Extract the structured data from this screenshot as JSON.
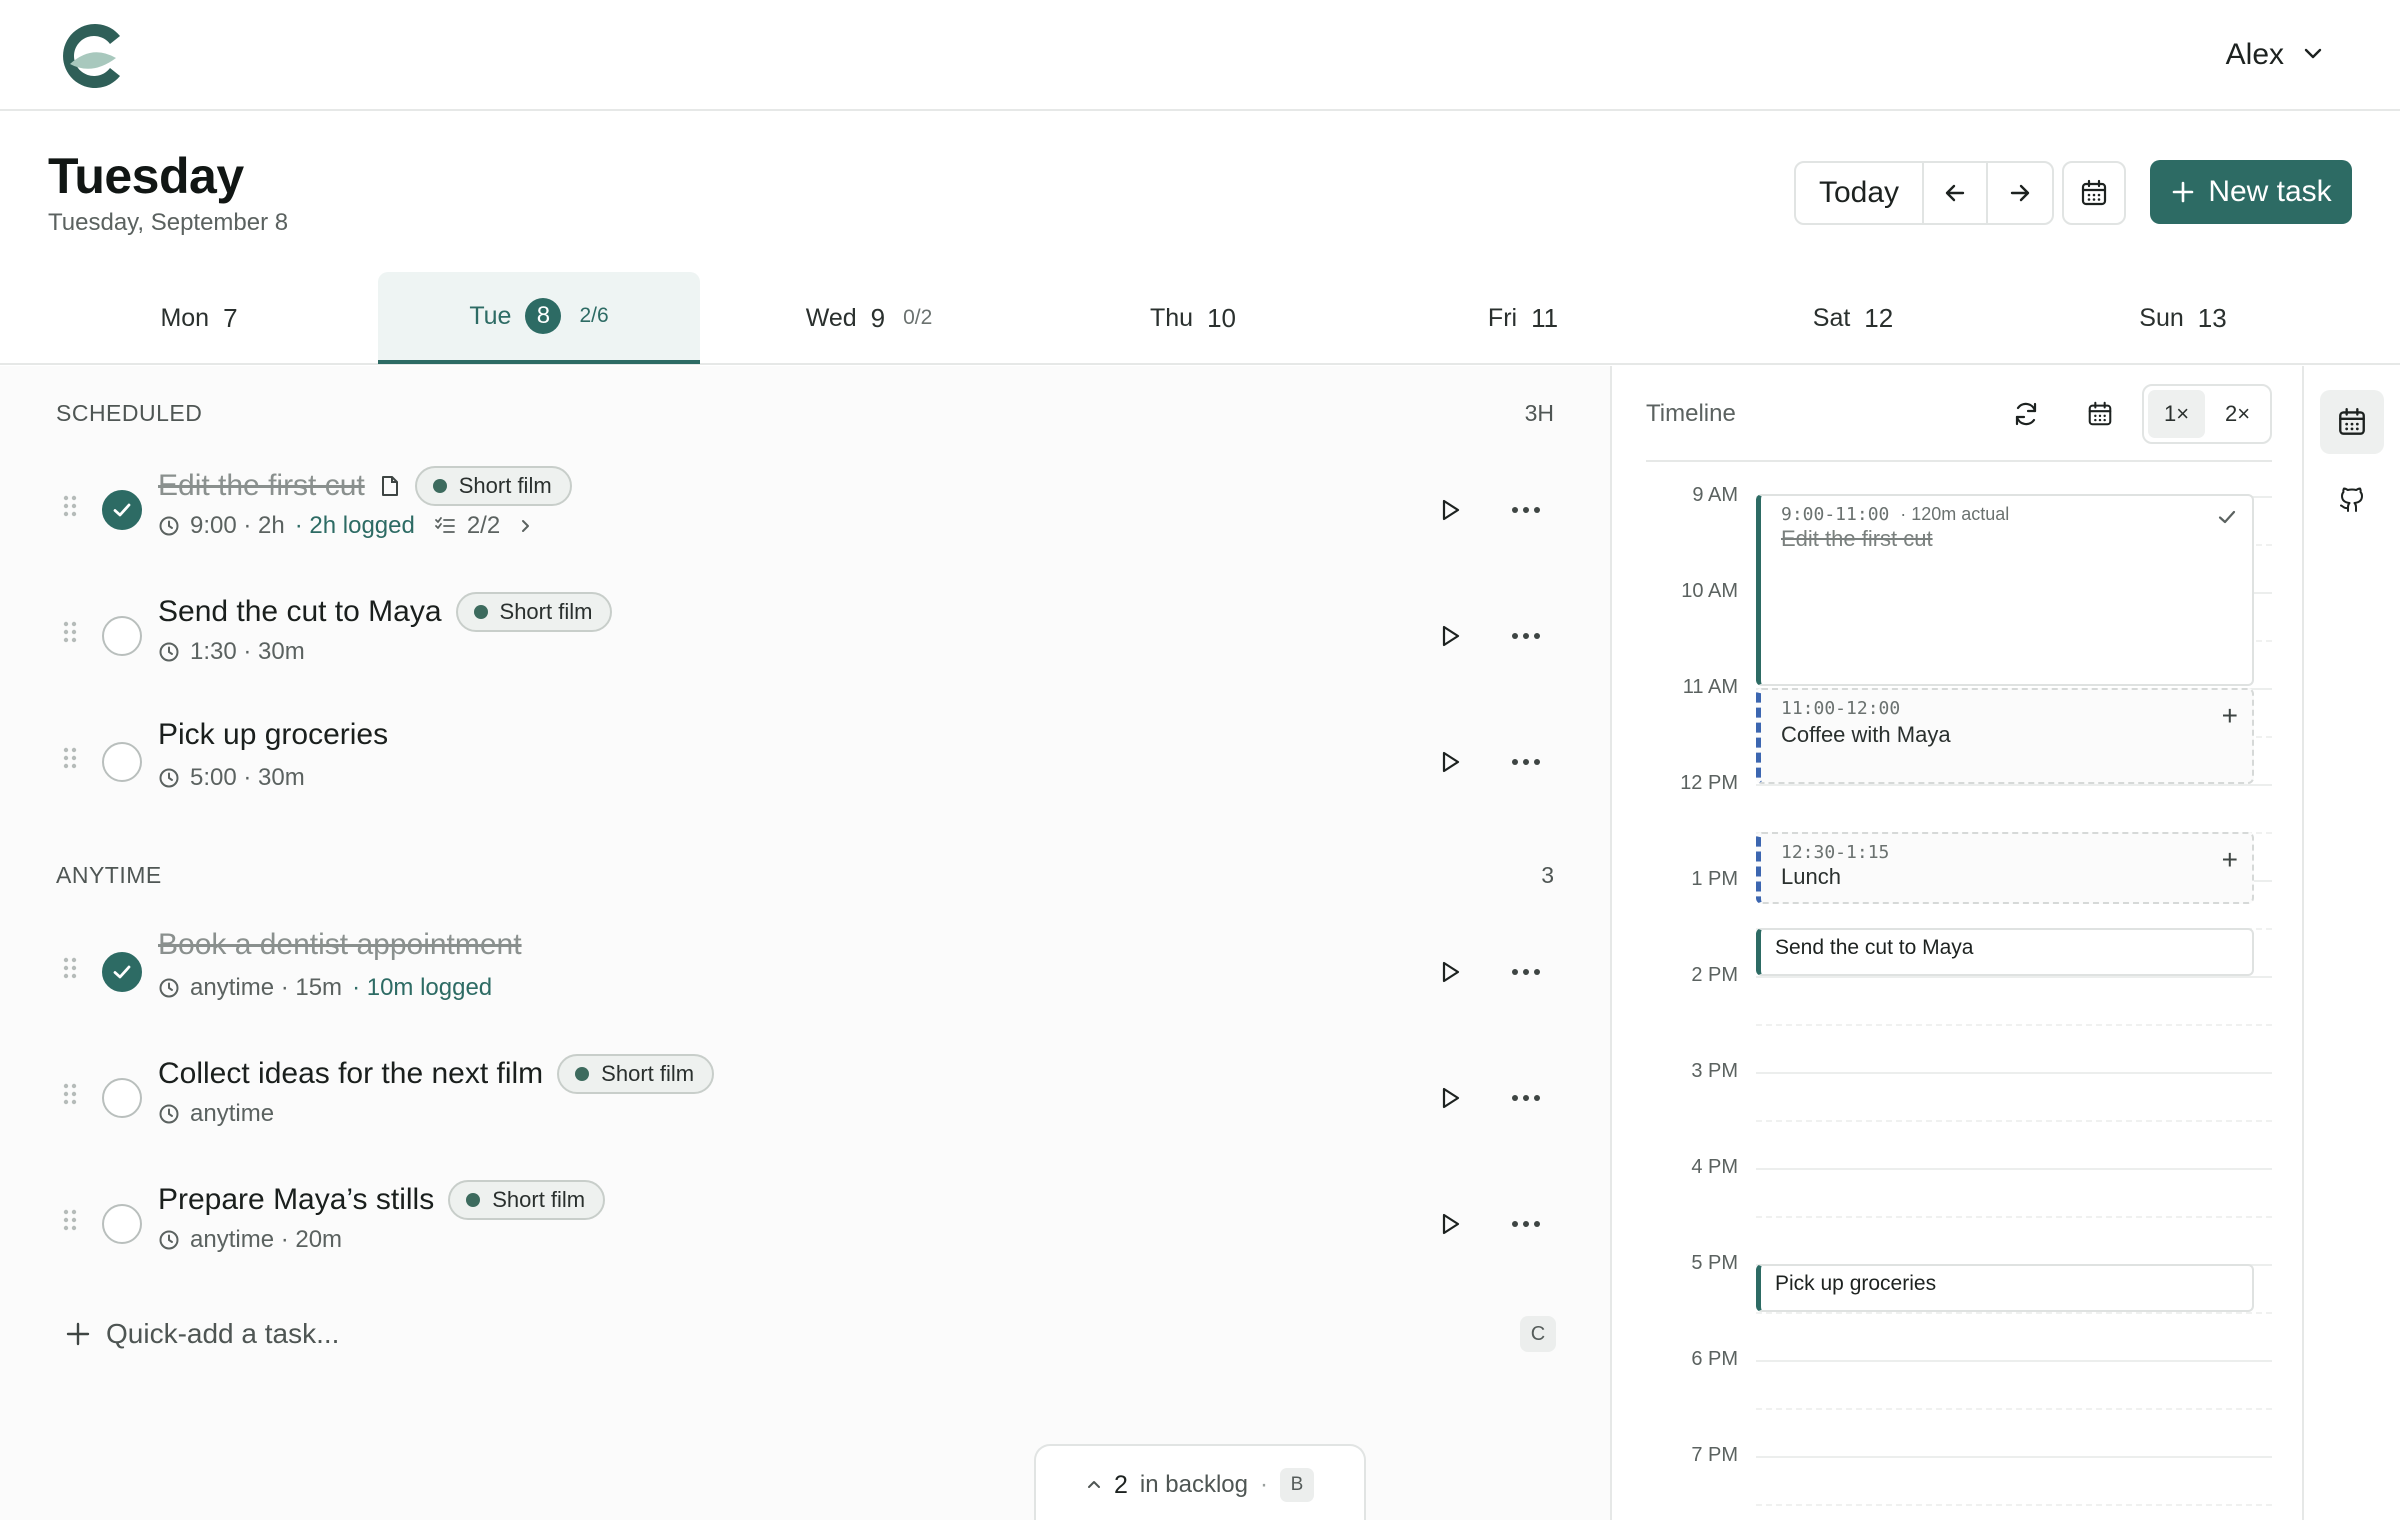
{
  "app": {
    "logo": "brand-logo",
    "accent": "#2d6b64"
  },
  "user": {
    "name": "Alex"
  },
  "header": {
    "title": "Tuesday",
    "subtitle": "Tuesday, September 8",
    "today_label": "Today",
    "new_task_label": "New task"
  },
  "days": [
    {
      "name": "Mon",
      "num": "7",
      "count": ""
    },
    {
      "name": "Tue",
      "num": "8",
      "count": "2/6"
    },
    {
      "name": "Wed",
      "num": "9",
      "count": "0/2"
    },
    {
      "name": "Thu",
      "num": "10",
      "count": ""
    },
    {
      "name": "Fri",
      "num": "11",
      "count": ""
    },
    {
      "name": "Sat",
      "num": "12",
      "count": ""
    },
    {
      "name": "Sun",
      "num": "13",
      "count": ""
    }
  ],
  "scheduled": {
    "label": "SCHEDULED",
    "meta": "3H",
    "tasks": [
      {
        "title": "Edit the first cut",
        "done": true,
        "tag": "Short film",
        "time": "9:00 · 2h",
        "logged": "· 2h logged",
        "subtasks": "2/2"
      },
      {
        "title": "Send the cut to Maya",
        "done": false,
        "tag": "Short film",
        "time": "1:30 · 30m",
        "logged": ""
      },
      {
        "title": "Pick up groceries",
        "done": false,
        "tag": "",
        "time": "5:00 · 30m",
        "logged": ""
      }
    ]
  },
  "anytime": {
    "label": "ANYTIME",
    "meta": "3",
    "tasks": [
      {
        "title": "Book a dentist appointment",
        "done": true,
        "tag": "",
        "time": "anytime · 15m",
        "logged": "· 10m logged"
      },
      {
        "title": "Collect ideas for the next film",
        "done": false,
        "tag": "Short film",
        "time": "anytime",
        "logged": ""
      },
      {
        "title": "Prepare Maya’s stills",
        "done": false,
        "tag": "Short film",
        "time": "anytime · 20m",
        "logged": ""
      }
    ]
  },
  "quickadd": {
    "placeholder": "Quick-add a task...",
    "shortcut": "C"
  },
  "backlog": {
    "count": "2",
    "label": "in backlog",
    "sep": "·",
    "shortcut": "B"
  },
  "timeline": {
    "title": "Timeline",
    "zoom_options": [
      "1×",
      "2×"
    ],
    "zoom_selected": "1×",
    "hours": [
      "9 AM",
      "10 AM",
      "11 AM",
      "12 PM",
      "1 PM",
      "2 PM",
      "3 PM",
      "4 PM",
      "5 PM",
      "6 PM",
      "7 PM"
    ],
    "events": [
      {
        "time": "9:00-11:00",
        "note": "· 120m actual",
        "name": "Edit the first cut",
        "kind": "task-done"
      },
      {
        "time": "11:00-12:00",
        "name": "Coffee with Maya",
        "kind": "calendar"
      },
      {
        "time": "12:30-1:15",
        "name": "Lunch",
        "kind": "calendar"
      },
      {
        "time": "",
        "name": "Send the cut to Maya",
        "kind": "task"
      },
      {
        "time": "",
        "name": "Pick up groceries",
        "kind": "task"
      }
    ]
  },
  "rail": {
    "items": [
      "calendar-icon",
      "github-icon"
    ]
  }
}
